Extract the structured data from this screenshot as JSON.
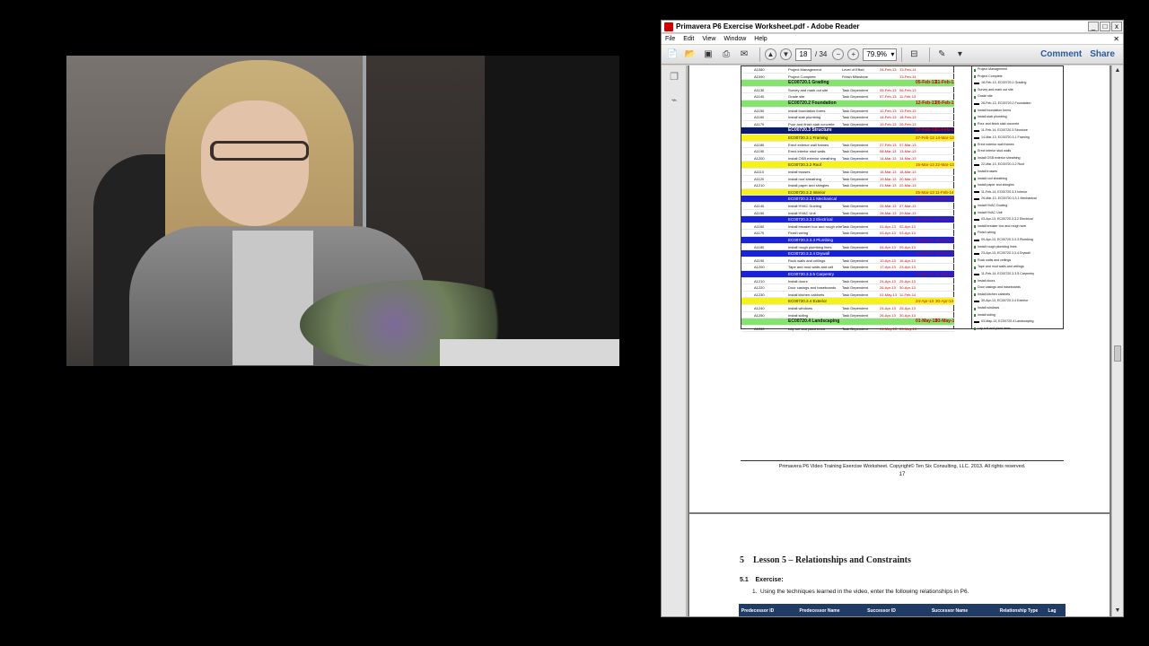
{
  "window": {
    "title": "Primavera P6 Exercise Worksheet.pdf - Adobe Reader",
    "buttons": [
      "_",
      "□",
      "x"
    ]
  },
  "menu": [
    "File",
    "Edit",
    "View",
    "Window",
    "Help"
  ],
  "toolbar": {
    "page_current": "18",
    "page_total": "/ 34",
    "zoom": "79.9%",
    "comment_label": "Comment",
    "share_label": "Share"
  },
  "gantt_rows": [
    {
      "style": "plain",
      "id": "A1080",
      "name": "Project Management",
      "type": "Level of Effort",
      "d1": "24-Feb-13",
      "d2": "13-Feb-14"
    },
    {
      "style": "plain",
      "id": "A1090",
      "name": "Project Complete",
      "type": "Finish Milestone",
      "d1": "",
      "d2": "13-Feb-14"
    },
    {
      "style": "wbs-green",
      "id": "",
      "name": "EC00720.1 Grading",
      "type": "",
      "d1": "05-Feb-13",
      "d2": "11-Feb-13"
    },
    {
      "style": "plain",
      "id": "A1130",
      "name": "Survey and mark out site",
      "type": "Task Dependent",
      "d1": "05-Feb-13",
      "d2": "06-Feb-13"
    },
    {
      "style": "plain",
      "id": "A1140",
      "name": "Grade site",
      "type": "Task Dependent",
      "d1": "07-Feb-13",
      "d2": "11-Feb-13"
    },
    {
      "style": "wbs-green",
      "id": "",
      "name": "EC00720.2 Foundation",
      "type": "",
      "d1": "12-Feb-13",
      "d2": "26-Feb-13"
    },
    {
      "style": "plain",
      "id": "A1150",
      "name": "Install foundation forms",
      "type": "Task Dependent",
      "d1": "12-Feb-13",
      "d2": "13-Feb-13"
    },
    {
      "style": "plain",
      "id": "A1160",
      "name": "Install slab plumbing",
      "type": "Task Dependent",
      "d1": "14-Feb-13",
      "d2": "18-Feb-13"
    },
    {
      "style": "plain",
      "id": "A1170",
      "name": "Pour and finish slab concrete",
      "type": "Task Dependent",
      "d1": "19-Feb-13",
      "d2": "26-Feb-13"
    },
    {
      "style": "wbs-navy",
      "id": "",
      "name": "EC00720.3 Structure",
      "type": "",
      "d1": "27-Feb-13",
      "d2": "11-Feb-14"
    },
    {
      "style": "wbs-yellow",
      "id": "",
      "name": "EC00720.3.1 Framing",
      "type": "",
      "d1": "27-Feb-13",
      "d2": "14-Mar-13"
    },
    {
      "style": "plain",
      "id": "A1180",
      "name": "Erect exterior wall frames",
      "type": "Task Dependent",
      "d1": "27-Feb-13",
      "d2": "07-Mar-13"
    },
    {
      "style": "plain",
      "id": "A1190",
      "name": "Erect interior stud walls",
      "type": "Task Dependent",
      "d1": "08-Mar-13",
      "d2": "13-Mar-13"
    },
    {
      "style": "plain",
      "id": "A1200",
      "name": "Install OSB exterior sheathing",
      "type": "Task Dependent",
      "d1": "14-Mar-13",
      "d2": "14-Mar-13"
    },
    {
      "style": "wbs-yellow",
      "id": "",
      "name": "EC00720.3.2 Roof",
      "type": "",
      "d1": "15-Mar-13",
      "d2": "22-Mar-13"
    },
    {
      "style": "plain",
      "id": "A1110",
      "name": "Install trusses",
      "type": "Task Dependent",
      "d1": "15-Mar-13",
      "d2": "18-Mar-13"
    },
    {
      "style": "plain",
      "id": "A1120",
      "name": "Install roof sheathing",
      "type": "Task Dependent",
      "d1": "19-Mar-13",
      "d2": "20-Mar-13"
    },
    {
      "style": "plain",
      "id": "A1210",
      "name": "Install paper and shingles",
      "type": "Task Dependent",
      "d1": "21-Mar-13",
      "d2": "22-Mar-13"
    },
    {
      "style": "wbs-yellow",
      "id": "",
      "name": "EC00720.3.3 Interior",
      "type": "",
      "d1": "25-Mar-13",
      "d2": "11-Feb-14"
    },
    {
      "style": "wbs-blue",
      "id": "",
      "name": "EC00720.3.3.1 Mechanical",
      "type": "",
      "d1": "25-Mar-13",
      "d2": "29-Mar-13"
    },
    {
      "style": "plain",
      "id": "A1140",
      "name": "Install HVAC Ducting",
      "type": "Task Dependent",
      "d1": "25-Mar-13",
      "d2": "27-Mar-13"
    },
    {
      "style": "plain",
      "id": "A1150",
      "name": "Install HVAC Unit",
      "type": "Task Dependent",
      "d1": "28-Mar-13",
      "d2": "29-Mar-13"
    },
    {
      "style": "wbs-blue",
      "id": "",
      "name": "EC00720.3.3.2 Electrical",
      "type": "",
      "d1": "01-Apr-13",
      "d2": "03-Apr-13"
    },
    {
      "style": "plain",
      "id": "A1160",
      "name": "Install breaker box and rough wire",
      "type": "Task Dependent",
      "d1": "01-Apr-13",
      "d2": "02-Apr-13"
    },
    {
      "style": "plain",
      "id": "A1170",
      "name": "Finish wiring",
      "type": "Task Dependent",
      "d1": "03-Apr-13",
      "d2": "03-Apr-13"
    },
    {
      "style": "wbs-blue",
      "id": "",
      "name": "EC00720.3.3.3 Plumbing",
      "type": "",
      "d1": "04-Apr-13",
      "d2": "09-Apr-13"
    },
    {
      "style": "plain",
      "id": "A1180",
      "name": "Install rough plumbing lines",
      "type": "Task Dependent",
      "d1": "04-Apr-13",
      "d2": "09-Apr-13"
    },
    {
      "style": "wbs-blue",
      "id": "",
      "name": "EC00720.3.3.4 Drywall",
      "type": "",
      "d1": "10-Apr-13",
      "d2": "23-Apr-13"
    },
    {
      "style": "plain",
      "id": "A1190",
      "name": "Rock walls and ceilings",
      "type": "Task Dependent",
      "d1": "10-Apr-13",
      "d2": "16-Apr-13"
    },
    {
      "style": "plain",
      "id": "A1200",
      "name": "Tape and mud walls and ceil",
      "type": "Task Dependent",
      "d1": "17-Apr-13",
      "d2": "23-Apr-13"
    },
    {
      "style": "wbs-blue",
      "id": "",
      "name": "EC00720.3.3.5 Carpentry",
      "type": "",
      "d1": "24-Apr-13",
      "d2": "11-Feb-14"
    },
    {
      "style": "plain",
      "id": "A1210",
      "name": "Install doors",
      "type": "Task Dependent",
      "d1": "24-Apr-13",
      "d2": "25-Apr-13"
    },
    {
      "style": "plain",
      "id": "A1220",
      "name": "Door casings and baseboards",
      "type": "Task Dependent",
      "d1": "26-Apr-13",
      "d2": "30-Apr-13"
    },
    {
      "style": "plain",
      "id": "A1230",
      "name": "Install kitchen cabinets",
      "type": "Task Dependent",
      "d1": "01-May-13",
      "d2": "11-Feb-14"
    },
    {
      "style": "wbs-yellow",
      "id": "",
      "name": "EC00720.3.4 Exterior",
      "type": "",
      "d1": "24-Apr-13",
      "d2": "30-Apr-13"
    },
    {
      "style": "plain",
      "id": "A1240",
      "name": "Install windows",
      "type": "Task Dependent",
      "d1": "24-Apr-13",
      "d2": "25-Apr-13"
    },
    {
      "style": "plain",
      "id": "A1250",
      "name": "Install siding",
      "type": "Task Dependent",
      "d1": "26-Apr-13",
      "d2": "30-Apr-13"
    },
    {
      "style": "wbs-green",
      "id": "",
      "name": "EC00720.4 Landscaping",
      "type": "",
      "d1": "01-May-13",
      "d2": "03-May-13"
    },
    {
      "style": "plain",
      "id": "A1260",
      "name": "Lay turf and plant trees",
      "type": "Task Dependent",
      "d1": "01-May-13",
      "d2": "03-May-13"
    }
  ],
  "gantt_labels": [
    "Project Management",
    "Project Complete",
    "18-Feb-13, EC00720.1 Grading",
    "Survey and mark out site",
    "Grade site",
    "26-Feb-13, EC00720.2 Foundation",
    "Install foundation forms",
    "Install slab plumbing",
    "Pour and finish slab concrete",
    "11-Feb-14, EC00720.3 Structure",
    "14-Mar-13, EC00720.3.1 Framing",
    "Erect exterior wall frames",
    "Erect interior stud walls",
    "Install OSB exterior sheathing",
    "22-Mar-13, EC00720.3.2 Roof",
    "Install trusses",
    "Install roof sheathing",
    "Install paper and shingles",
    "11-Feb-14, EC00720.3.3 Interior",
    "29-Mar-13, EC00720.3.3.1 Mechanical",
    "Install HVAC Ducting",
    "Install HVAC Unit",
    "03-Apr-13, EC00720.3.3.2 Electrical",
    "Install breaker box and rough wire",
    "Finish wiring",
    "09-Apr-13, EC00720.3.3.3 Plumbing",
    "Install rough plumbing lines",
    "23-Apr-13, EC00720.3.3.4 Drywall",
    "Rock walls and ceilings",
    "Tape and mud walls and ceilings",
    "11-Feb-14, EC00720.3.3.5 Carpentry",
    "Install doors",
    "Door casings and baseboards",
    "Install kitchen cabinets",
    "30-Apr-13, EC00720.3.4 Exterior",
    "Install windows",
    "Install siding",
    "03-May-13, EC00720.4 Landscaping",
    "Lay turf and plant trees"
  ],
  "page1": {
    "footer": "Primavera P6 Video Training Exercise Worksheet.  Copyright© Ten Six Consulting, LLC. 2013.  All rights reserved.",
    "page_number": "17"
  },
  "page2": {
    "section_num": "5",
    "section_title": "Lesson 5 – Relationships and Constraints",
    "subsection": "5.1",
    "subsection_title": "Exercise:",
    "instruction_num": "1.",
    "instruction": "Using the techniques learned in the video, enter the following relationships in P6.",
    "table_headers": [
      "Predecessor ID",
      "Predecessor Name",
      "Successor ID",
      "Successor Name",
      "Relationship Type",
      "Lag"
    ]
  }
}
